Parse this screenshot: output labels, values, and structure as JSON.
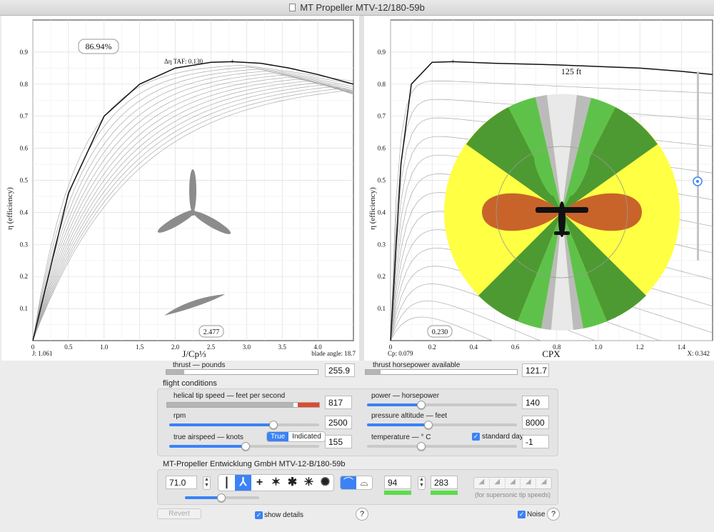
{
  "window": {
    "title": "MT Propeller MTV-12/180-59b"
  },
  "left_chart": {
    "efficiency_badge": "86.94%",
    "taf_label": "Δη TAF: 0.130",
    "x_badge": "2.477",
    "bottom_left": "J: 1.061",
    "bottom_right": "blade angle: 18.7",
    "xlabel": "J/Cp⅓",
    "ylabel": "η (efficiency)"
  },
  "right_chart": {
    "distance_label": "125 ft",
    "x_badge": "0.230",
    "bottom_left": "Cp: 0.079",
    "bottom_right": "X: 0.342",
    "xlabel": "CPX",
    "ylabel": "η (efficiency)"
  },
  "chart_data": [
    {
      "type": "line",
      "title": "",
      "xlabel": "J/Cp⅓",
      "ylabel": "η (efficiency)",
      "xlim": [
        0,
        4.5
      ],
      "ylim": [
        0,
        1.0
      ],
      "xticks": [
        "0",
        "0.5",
        "1.0",
        "1.5",
        "2.0",
        "2.5",
        "3.0",
        "3.5",
        "4.0"
      ],
      "yticks": [
        "0.1",
        "0.2",
        "0.3",
        "0.4",
        "0.5",
        "0.6",
        "0.7",
        "0.8",
        "0.9"
      ],
      "series": [
        {
          "x": [
            0,
            0.5,
            1.0,
            1.5,
            2.0,
            2.5,
            2.8,
            3.2,
            3.6,
            4.0,
            4.5
          ],
          "values": [
            0,
            0.46,
            0.7,
            0.8,
            0.85,
            0.868,
            0.87,
            0.865,
            0.85,
            0.83,
            0.8
          ]
        }
      ]
    },
    {
      "type": "line",
      "title": "",
      "xlabel": "CPX",
      "ylabel": "η (efficiency)",
      "xlim": [
        0,
        1.55
      ],
      "ylim": [
        0,
        1.0
      ],
      "xticks": [
        "0",
        "0.2",
        "0.4",
        "0.6",
        "0.8",
        "1.0",
        "1.2",
        "1.4"
      ],
      "yticks": [
        "0.1",
        "0.2",
        "0.3",
        "0.4",
        "0.5",
        "0.6",
        "0.7",
        "0.8",
        "0.9"
      ],
      "series": [
        {
          "x": [
            0,
            0.05,
            0.1,
            0.2,
            0.3,
            0.5,
            0.8,
            1.0,
            1.2,
            1.4,
            1.55
          ],
          "values": [
            0,
            0.55,
            0.8,
            0.868,
            0.87,
            0.865,
            0.86,
            0.855,
            0.85,
            0.84,
            0.83
          ]
        }
      ]
    }
  ],
  "outputs": {
    "thrust_label": "thrust — pounds",
    "thrust_value": "255.9",
    "thrust_fraction": 0.12,
    "thp_label": "thrust horsepower available",
    "thp_value": "121.7",
    "thp_fraction": 0.1
  },
  "flight": {
    "title": "flight conditions",
    "tip_speed_label": "helical tip speed — feet per second",
    "tip_speed_value": "817",
    "rpm_label": "rpm",
    "rpm_value": "2500",
    "airspeed_label": "true airspeed — knots",
    "airspeed_true": "True",
    "airspeed_indicated": "Indicated",
    "airspeed_value": "155",
    "power_label": "power — horsepower",
    "power_value": "140",
    "altitude_label": "pressure altitude — feet",
    "altitude_value": "8000",
    "temperature_label": "temperature — ° C",
    "temperature_value": "-1",
    "standard_day_label": "standard day"
  },
  "propeller": {
    "title": "MT-Propeller Entwicklung GmbH MTV-12-B/180-59b",
    "diameter_value": "71.0",
    "blade_symbols": [
      "❘",
      "⅄",
      "+",
      "✶",
      "✱",
      "✳",
      "✺"
    ],
    "field_a": "94",
    "field_b": "283",
    "supersonic_note": "(for supersonic tip speeds)"
  },
  "footer": {
    "revert_label": "Revert",
    "show_details_label": "show details",
    "noise_label": "Noise",
    "help_label": "?"
  },
  "colors": {
    "accent": "#3b82f6",
    "green": "#5ddb4c",
    "yellow": "#ffff44",
    "orange": "#c8642a",
    "red": "#e04a2e"
  }
}
